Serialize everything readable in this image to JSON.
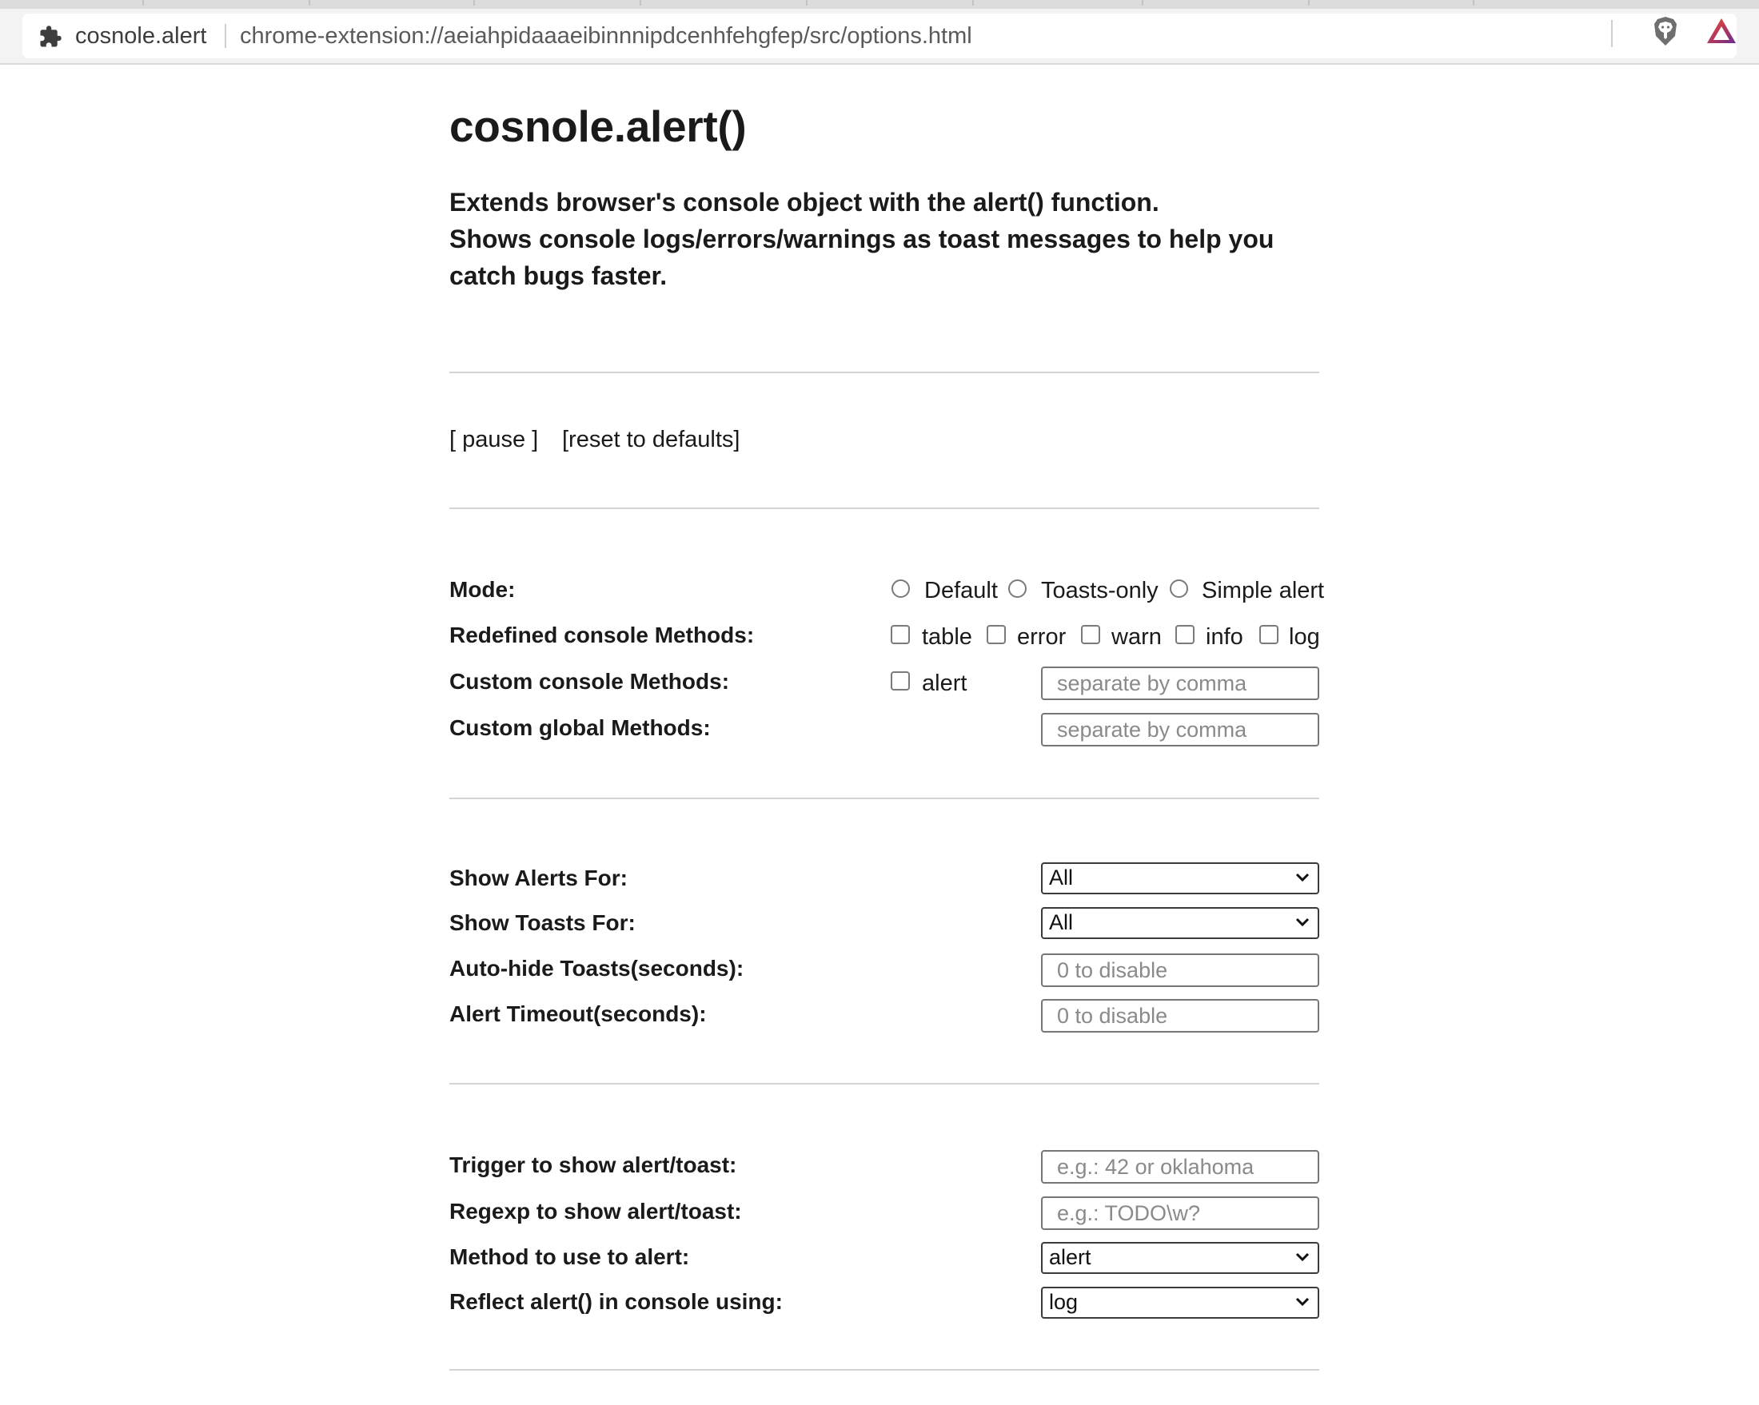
{
  "browser": {
    "site_name": "cosnole.alert",
    "url": "chrome-extension://aeiahpidaaaeibinnnipdcenhfehgfep/src/options.html"
  },
  "page": {
    "title": "cosnole.alert()",
    "description_lines": [
      "Extends browser's console object with the alert() function.",
      "Shows console logs/errors/warnings as toast messages to help you",
      "catch bugs faster."
    ]
  },
  "controls": {
    "pause": "[ pause ]",
    "reset": "[reset to defaults]"
  },
  "mode": {
    "label": "Mode:",
    "options": [
      "Default",
      "Toasts-only",
      "Simple alert"
    ]
  },
  "redefined": {
    "label": "Redefined console Methods:",
    "options": [
      "table",
      "error",
      "warn",
      "info",
      "log"
    ]
  },
  "custom_console": {
    "label": "Custom console Methods:",
    "option": "alert",
    "placeholder": "separate by comma",
    "value": ""
  },
  "custom_global": {
    "label": "Custom global Methods:",
    "placeholder": "separate by comma",
    "value": ""
  },
  "show_alerts": {
    "label": "Show Alerts For:",
    "value": "All"
  },
  "show_toasts": {
    "label": "Show Toasts For:",
    "value": "All"
  },
  "auto_hide": {
    "label": "Auto-hide Toasts(seconds):",
    "placeholder": "0 to disable",
    "value": ""
  },
  "alert_timeout": {
    "label": "Alert Timeout(seconds):",
    "placeholder": "0 to disable",
    "value": ""
  },
  "trigger": {
    "label": "Trigger to show alert/toast:",
    "placeholder": "e.g.: 42 or oklahoma",
    "value": ""
  },
  "regexp": {
    "label": "Regexp to show alert/toast:",
    "placeholder": "e.g.: TODO\\w?",
    "value": ""
  },
  "method_alert": {
    "label": "Method to use to alert:",
    "value": "alert"
  },
  "reflect": {
    "label": "Reflect alert() in console using:",
    "value": "log"
  },
  "icons": {
    "extension": "puzzle-piece-icon",
    "shields": "brave-lion-shield-icon",
    "rewards": "brave-rewards-triangle-icon",
    "select": "chevron-down-icon"
  },
  "colors": {
    "text": "#1a1a1a",
    "rule": "#d4d4d4",
    "placeholder": "#8a8a8a",
    "rewards_start": "#ff4724",
    "rewards_end": "#662d91"
  }
}
